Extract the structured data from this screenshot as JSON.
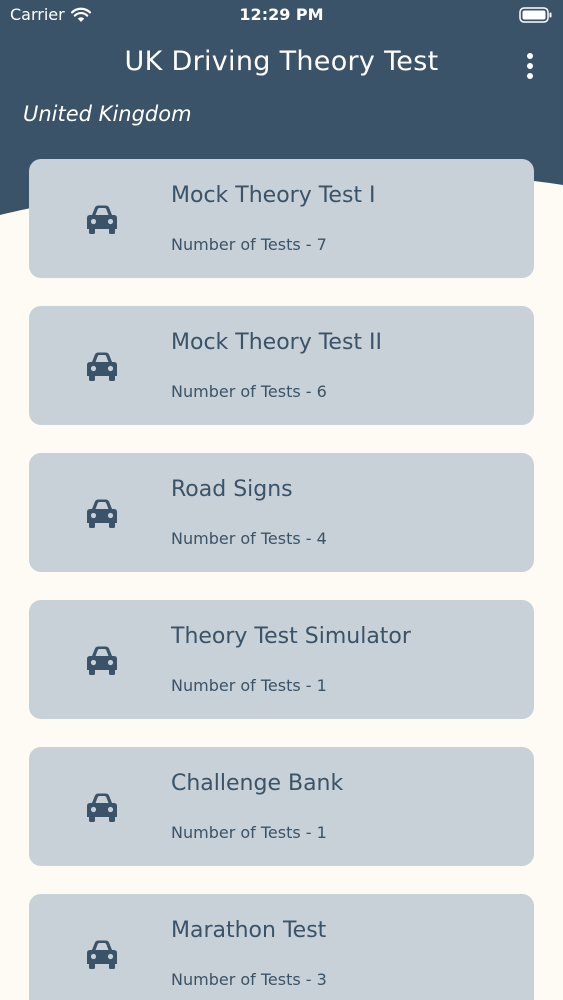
{
  "status_bar": {
    "carrier": "Carrier",
    "time": "12:29 PM"
  },
  "header": {
    "title": "UK Driving Theory Test",
    "region": "United Kingdom",
    "menu_icon": "more-vertical-icon"
  },
  "colors": {
    "header_bg": "#3a5368",
    "page_bg": "#fdfbf4",
    "card_bg": "#c8d0d8",
    "text_dark": "#3a5368"
  },
  "cards": [
    {
      "title": "Mock Theory Test I",
      "subtitle": "Number of Tests - 7",
      "icon": "car-icon"
    },
    {
      "title": "Mock Theory Test II",
      "subtitle": "Number of Tests - 6",
      "icon": "car-icon"
    },
    {
      "title": "Road Signs",
      "subtitle": "Number of Tests - 4",
      "icon": "car-icon"
    },
    {
      "title": "Theory Test Simulator",
      "subtitle": "Number of Tests - 1",
      "icon": "car-icon"
    },
    {
      "title": "Challenge Bank",
      "subtitle": "Number of Tests - 1",
      "icon": "car-icon"
    },
    {
      "title": "Marathon Test",
      "subtitle": "Number of Tests - 3",
      "icon": "car-icon"
    }
  ]
}
